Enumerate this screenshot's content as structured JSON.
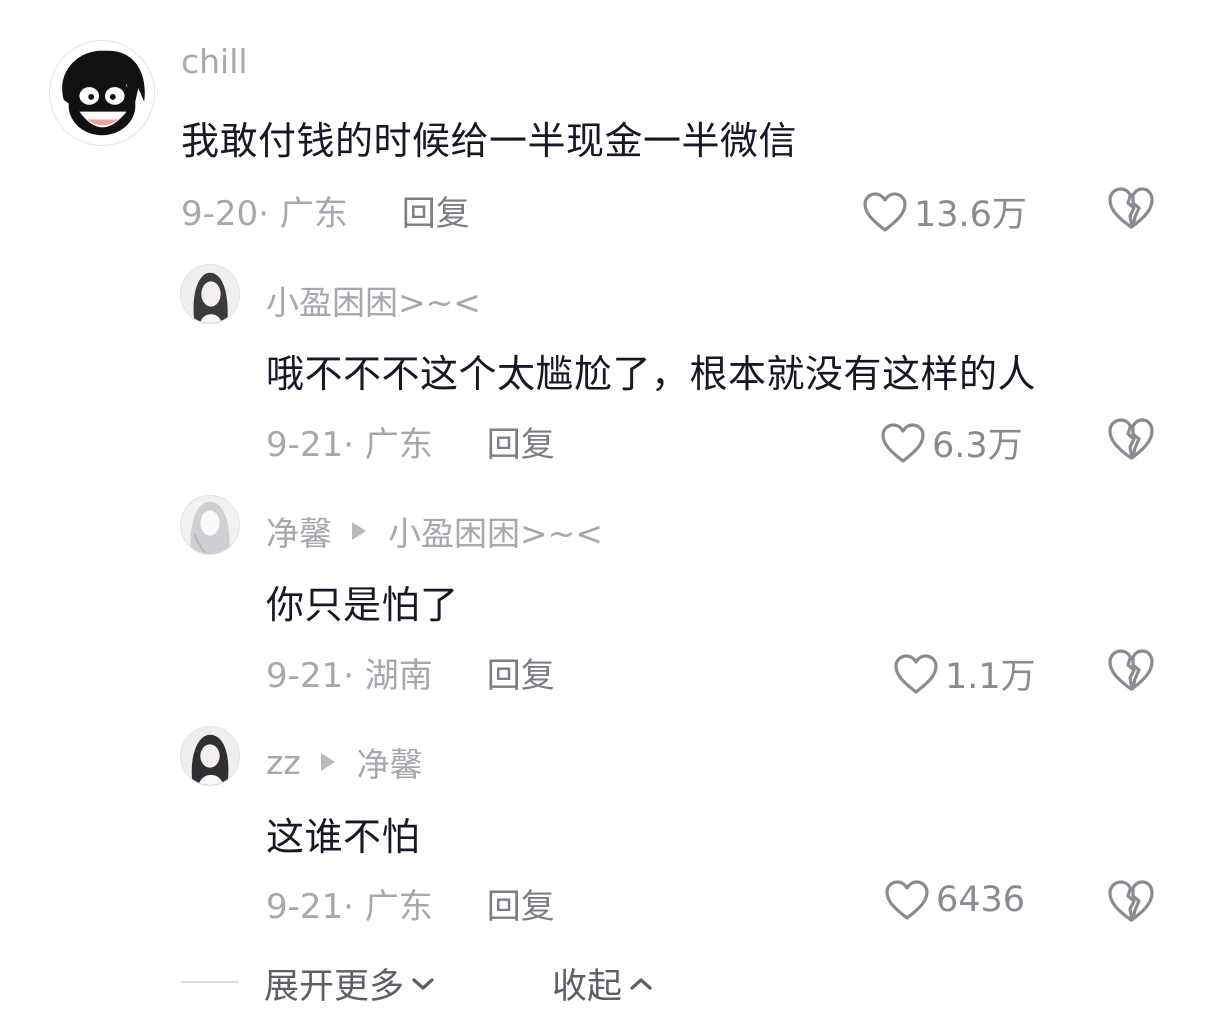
{
  "comments": [
    {
      "username": "chill",
      "text": "我敢付钱的时候给一半现金一半微信",
      "date_location": "9-20· 广东",
      "reply_label": "回复",
      "likes": "13.6万"
    },
    {
      "username": "小盈困困>~<",
      "text": "哦不不不这个太尴尬了，根本就没有这样的人",
      "date_location": "9-21· 广东",
      "reply_label": "回复",
      "likes": "6.3万"
    },
    {
      "username": "净馨",
      "reply_to": "小盈困困>~<",
      "text": "你只是怕了",
      "date_location": "9-21· 湖南",
      "reply_label": "回复",
      "likes": "1.1万"
    },
    {
      "username": "zz",
      "reply_to": "净馨",
      "text": "这谁不怕",
      "date_location": "9-21· 广东",
      "reply_label": "回复",
      "likes": "6436"
    }
  ],
  "footer": {
    "expand_label": "展开更多",
    "collapse_label": "收起"
  },
  "colors": {
    "text_primary": "#161823",
    "text_secondary": "#a7a8ad",
    "icon_gray": "#8a8b90"
  },
  "icons": {
    "like": "heart-outline-icon",
    "dislike": "broken-heart-icon",
    "expand": "chevron-down-icon",
    "collapse": "chevron-up-icon"
  }
}
